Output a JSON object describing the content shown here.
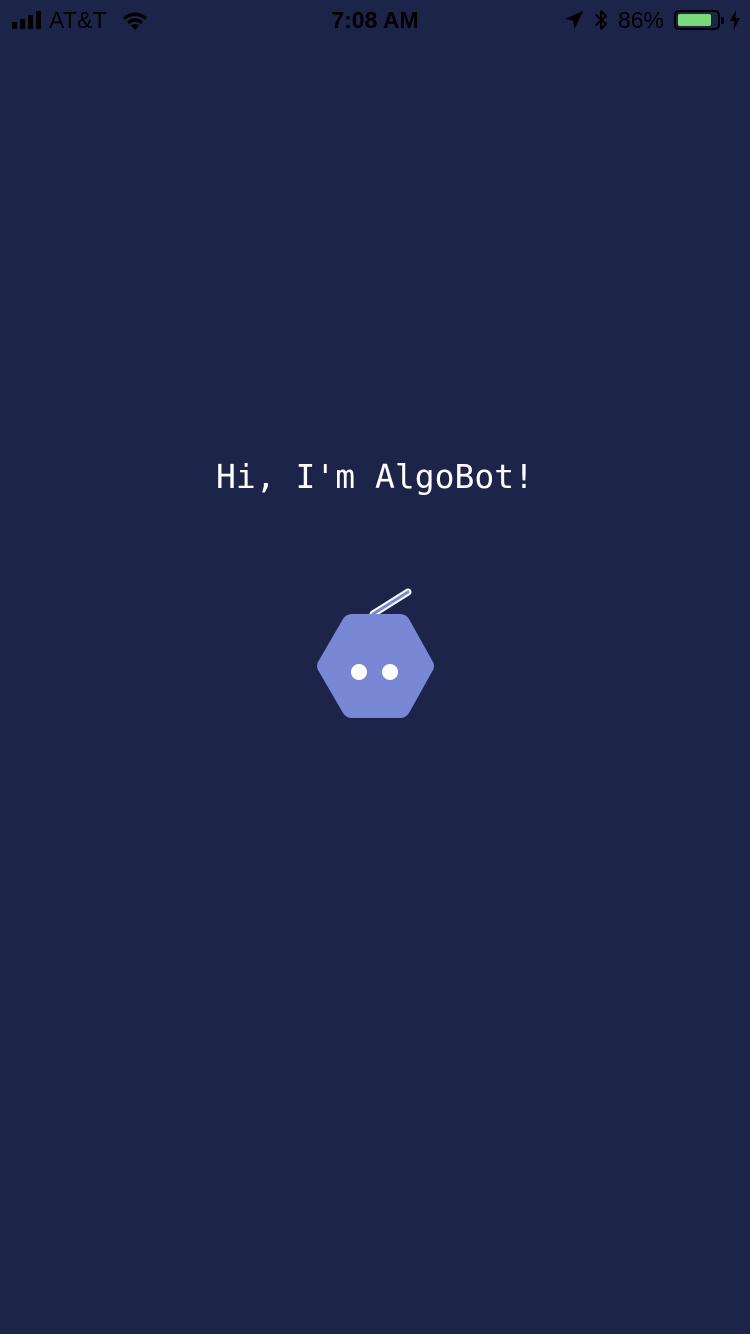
{
  "status_bar": {
    "carrier": "AT&T",
    "time": "7:08 AM",
    "battery_percent": "86%",
    "battery_level": 0.86,
    "icons": [
      "signal-icon",
      "wifi-icon",
      "location-icon",
      "bluetooth-icon",
      "battery-icon",
      "charging-icon"
    ]
  },
  "greeting": {
    "text": "Hi, I'm AlgoBot!"
  },
  "bot": {
    "icon": "robot-hexagon-icon",
    "body_color": "#7888d4",
    "eye_color": "#ffffff",
    "antenna_color": "#7888d4"
  },
  "colors": {
    "background": "#1c2449",
    "text": "#ffffff",
    "battery": "#7cd979"
  }
}
